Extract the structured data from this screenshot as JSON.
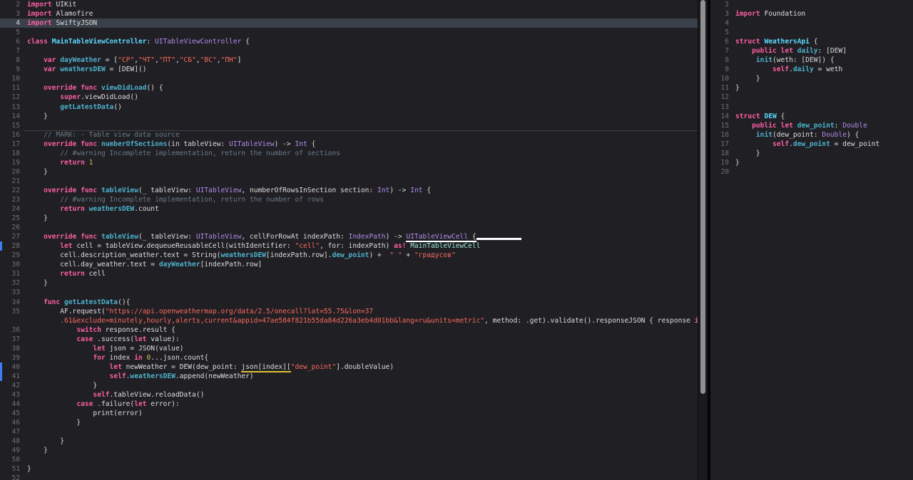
{
  "colors": {
    "background": "#1F1F24",
    "keyword": "#FC5FA3",
    "string": "#FC6A5D",
    "number": "#D0BF69",
    "comment": "#6C7986",
    "declaration_teal": "#4EB1CC",
    "sdk_type_lavender": "#B48CEB",
    "type_declaration_cyan": "#5DD8FF",
    "project_class_mint": "#9FE8D5",
    "plain_text": "#DFDFE0",
    "line_number": "#6F6F74",
    "current_line_highlight": "#3A4049",
    "change_bar_blue": "#3D7DF5",
    "scrollbar_thumb": "#8F8F94"
  },
  "left_editor": {
    "scrollbar_thumb_height": 553,
    "lines": [
      {
        "num": "2",
        "tok": [
          [
            "k",
            "import "
          ],
          [
            "p",
            "UIKit"
          ]
        ]
      },
      {
        "num": "3",
        "tok": [
          [
            "k",
            "import "
          ],
          [
            "p",
            "Alamofire"
          ]
        ]
      },
      {
        "num": "4",
        "hl": true,
        "tok": [
          [
            "k",
            "import "
          ],
          [
            "p",
            "SwiftyJSON"
          ]
        ]
      },
      {
        "num": "5",
        "tok": []
      },
      {
        "num": "6",
        "tok": [
          [
            "k",
            "class "
          ],
          [
            "y",
            "MainTableViewController"
          ],
          [
            "p",
            ": "
          ],
          [
            "t",
            "UITableViewController"
          ],
          [
            "p",
            " {"
          ]
        ]
      },
      {
        "num": "7",
        "tok": []
      },
      {
        "num": "8",
        "tok": [
          [
            "p",
            "    "
          ],
          [
            "k",
            "var "
          ],
          [
            "d",
            "dayWeather"
          ],
          [
            "p",
            " = ["
          ],
          [
            "s",
            "\"СР\""
          ],
          [
            "p",
            ","
          ],
          [
            "s",
            "\"ЧТ\""
          ],
          [
            "p",
            ","
          ],
          [
            "s",
            "\"ПТ\""
          ],
          [
            "p",
            ","
          ],
          [
            "s",
            "\"СБ\""
          ],
          [
            "p",
            ","
          ],
          [
            "s",
            "\"ВС\""
          ],
          [
            "p",
            ","
          ],
          [
            "s",
            "\"ПН\""
          ],
          [
            "p",
            "]"
          ]
        ]
      },
      {
        "num": "9",
        "tok": [
          [
            "p",
            "    "
          ],
          [
            "k",
            "var "
          ],
          [
            "d",
            "weathersDEW"
          ],
          [
            "p",
            " = [DEW]()"
          ]
        ]
      },
      {
        "num": "10",
        "tok": []
      },
      {
        "num": "11",
        "tok": [
          [
            "p",
            "    "
          ],
          [
            "k",
            "override func "
          ],
          [
            "d",
            "viewDidLoad"
          ],
          [
            "p",
            "() {"
          ]
        ]
      },
      {
        "num": "12",
        "tok": [
          [
            "p",
            "        "
          ],
          [
            "k",
            "super"
          ],
          [
            "p",
            ".viewDidLoad()"
          ]
        ]
      },
      {
        "num": "13",
        "tok": [
          [
            "p",
            "        "
          ],
          [
            "d",
            "getLatestData"
          ],
          [
            "p",
            "()"
          ]
        ]
      },
      {
        "num": "14",
        "tok": [
          [
            "p",
            "    }"
          ]
        ]
      },
      {
        "num": "15",
        "tok": []
      },
      {
        "num": "16",
        "sep": true,
        "tok": [
          [
            "p",
            "    "
          ],
          [
            "c",
            "// MARK: - Table view data source"
          ]
        ]
      },
      {
        "num": "17",
        "tok": [
          [
            "p",
            "    "
          ],
          [
            "k",
            "override func "
          ],
          [
            "d",
            "numberOfSections"
          ],
          [
            "p",
            "(in tableView: "
          ],
          [
            "t",
            "UITableView"
          ],
          [
            "p",
            ") -> "
          ],
          [
            "t",
            "Int"
          ],
          [
            "p",
            " {"
          ]
        ]
      },
      {
        "num": "18",
        "tok": [
          [
            "p",
            "        "
          ],
          [
            "c",
            "// #warning Incomplete implementation, return the number of sections"
          ]
        ]
      },
      {
        "num": "19",
        "tok": [
          [
            "p",
            "        "
          ],
          [
            "k",
            "return "
          ],
          [
            "n",
            "1"
          ]
        ]
      },
      {
        "num": "20",
        "tok": [
          [
            "p",
            "    }"
          ]
        ]
      },
      {
        "num": "21",
        "tok": []
      },
      {
        "num": "22",
        "tok": [
          [
            "p",
            "    "
          ],
          [
            "k",
            "override func "
          ],
          [
            "d",
            "tableView"
          ],
          [
            "p",
            "(_ tableView: "
          ],
          [
            "t",
            "UITableView"
          ],
          [
            "p",
            ", numberOfRowsInSection section: "
          ],
          [
            "t",
            "Int"
          ],
          [
            "p",
            ") -> "
          ],
          [
            "t",
            "Int"
          ],
          [
            "p",
            " {"
          ]
        ]
      },
      {
        "num": "23",
        "tok": [
          [
            "p",
            "        "
          ],
          [
            "c",
            "// #warning Incomplete implementation, return the number of rows"
          ]
        ]
      },
      {
        "num": "24",
        "tok": [
          [
            "p",
            "        "
          ],
          [
            "k",
            "return "
          ],
          [
            "d",
            "weathersDEW"
          ],
          [
            "p",
            ".count"
          ]
        ]
      },
      {
        "num": "25",
        "tok": [
          [
            "p",
            "    }"
          ]
        ]
      },
      {
        "num": "26",
        "tok": []
      },
      {
        "num": "27",
        "tok": [
          [
            "p",
            "    "
          ],
          [
            "k",
            "override func "
          ],
          [
            "d",
            "tableView"
          ],
          [
            "p",
            "(_ tableView: "
          ],
          [
            "t",
            "UITableView"
          ],
          [
            "p",
            ", cellForRowAt indexPath: "
          ],
          [
            "t",
            "IndexPath"
          ],
          [
            "p",
            ") -> "
          ],
          [
            "tu",
            "UITableViewCell"
          ],
          [
            "pu",
            " {"
          ],
          [
            "wb",
            ""
          ]
        ]
      },
      {
        "num": "28",
        "chbar": true,
        "tok": [
          [
            "p",
            "        "
          ],
          [
            "k",
            "let "
          ],
          [
            "p",
            "cell = tableView.dequeueReusableCell(withIdentifier: "
          ],
          [
            "s",
            "\"cell\""
          ],
          [
            "p",
            ", for: indexPath) "
          ],
          [
            "k",
            "as!"
          ],
          [
            "p",
            " "
          ],
          [
            "m",
            "MainTableViewCell"
          ]
        ]
      },
      {
        "num": "29",
        "tok": [
          [
            "p",
            "        "
          ],
          [
            "p",
            "cell.description_weather.text = String("
          ],
          [
            "d",
            "weathersDEW"
          ],
          [
            "p",
            "[indexPath.row]."
          ],
          [
            "d",
            "dew_point"
          ],
          [
            "p",
            ") +  "
          ],
          [
            "s",
            "\" \""
          ],
          [
            "p",
            " + "
          ],
          [
            "s",
            "\"градусов\""
          ]
        ]
      },
      {
        "num": "30",
        "tok": [
          [
            "p",
            "        "
          ],
          [
            "p",
            "cell.day_weather.text = "
          ],
          [
            "d",
            "dayWeather"
          ],
          [
            "p",
            "[indexPath.row]"
          ]
        ]
      },
      {
        "num": "31",
        "tok": [
          [
            "p",
            "        "
          ],
          [
            "k",
            "return "
          ],
          [
            "p",
            "cell"
          ]
        ]
      },
      {
        "num": "32",
        "tok": [
          [
            "p",
            "    }"
          ]
        ]
      },
      {
        "num": "33",
        "tok": []
      },
      {
        "num": "34",
        "tok": [
          [
            "p",
            "    "
          ],
          [
            "k",
            "func "
          ],
          [
            "d",
            "getLatestData"
          ],
          [
            "p",
            "(){"
          ]
        ]
      },
      {
        "num": "35",
        "tok": [
          [
            "p",
            "        "
          ],
          [
            "p",
            "AF.request("
          ],
          [
            "s",
            "\"https://api.openweathermap.org/data/2.5/onecall?lat=55.75&lon=37"
          ]
        ]
      },
      {
        "num": "",
        "tok": [
          [
            "p",
            "        "
          ],
          [
            "s",
            ".61&exclude=minutely,hourly,alerts,current&appid=47ae584f821b55da84d226a3eb4d01bb&lang=ru&units=metric\""
          ],
          [
            "p",
            ", method: .get).validate().responseJSON { response "
          ],
          [
            "k",
            "in"
          ]
        ]
      },
      {
        "num": "36",
        "tok": [
          [
            "p",
            "            "
          ],
          [
            "k",
            "switch "
          ],
          [
            "p",
            "response.result {"
          ]
        ]
      },
      {
        "num": "37",
        "tok": [
          [
            "p",
            "            "
          ],
          [
            "k",
            "case "
          ],
          [
            "p",
            ".success("
          ],
          [
            "k",
            "let"
          ],
          [
            "p",
            " value):"
          ]
        ]
      },
      {
        "num": "38",
        "tok": [
          [
            "p",
            "                "
          ],
          [
            "k",
            "let "
          ],
          [
            "p",
            "json = JSON(value)"
          ]
        ]
      },
      {
        "num": "39",
        "tok": [
          [
            "p",
            "                "
          ],
          [
            "k",
            "for "
          ],
          [
            "p",
            "index "
          ],
          [
            "k",
            "in "
          ],
          [
            "n",
            "0"
          ],
          [
            "p",
            "...json.count{"
          ]
        ]
      },
      {
        "num": "40",
        "chbar": true,
        "tok": [
          [
            "p",
            "                    "
          ],
          [
            "k",
            "let "
          ],
          [
            "p",
            "newWeather = DEW(dew_point: "
          ],
          [
            "yu",
            "json[index]["
          ],
          [
            "s",
            "\"dew_point\""
          ],
          [
            "p",
            "].doubleValue)"
          ]
        ]
      },
      {
        "num": "41",
        "chbar": true,
        "tok": [
          [
            "p",
            "                    "
          ],
          [
            "k",
            "self"
          ],
          [
            "p",
            "."
          ],
          [
            "d",
            "weathersDEW"
          ],
          [
            "p",
            ".append(newWeather)"
          ]
        ]
      },
      {
        "num": "42",
        "tok": [
          [
            "p",
            "                }"
          ]
        ]
      },
      {
        "num": "43",
        "tok": [
          [
            "p",
            "                "
          ],
          [
            "k",
            "self"
          ],
          [
            "p",
            ".tableView.reloadData()"
          ]
        ]
      },
      {
        "num": "44",
        "tok": [
          [
            "p",
            "            "
          ],
          [
            "k",
            "case "
          ],
          [
            "p",
            ".failure("
          ],
          [
            "k",
            "let"
          ],
          [
            "p",
            " error):"
          ]
        ]
      },
      {
        "num": "45",
        "tok": [
          [
            "p",
            "                "
          ],
          [
            "p",
            "print(error)"
          ]
        ]
      },
      {
        "num": "46",
        "tok": [
          [
            "p",
            "            }"
          ]
        ]
      },
      {
        "num": "47",
        "tok": []
      },
      {
        "num": "48",
        "tok": [
          [
            "p",
            "        }"
          ]
        ]
      },
      {
        "num": "49",
        "tok": [
          [
            "p",
            "    }"
          ]
        ]
      },
      {
        "num": "50",
        "tok": []
      },
      {
        "num": "51",
        "tok": [
          [
            "p",
            "}"
          ]
        ]
      },
      {
        "num": "52",
        "tok": []
      }
    ]
  },
  "right_editor": {
    "lines": [
      {
        "num": "2",
        "tok": []
      },
      {
        "num": "3",
        "tok": [
          [
            "k",
            "import "
          ],
          [
            "p",
            "Foundation"
          ]
        ]
      },
      {
        "num": "4",
        "tok": []
      },
      {
        "num": "5",
        "tok": []
      },
      {
        "num": "6",
        "tok": [
          [
            "k",
            "struct "
          ],
          [
            "y",
            "WeathersApi"
          ],
          [
            "p",
            " {"
          ]
        ]
      },
      {
        "num": "7",
        "tok": [
          [
            "p",
            "    "
          ],
          [
            "k",
            "public let "
          ],
          [
            "d",
            "daily"
          ],
          [
            "p",
            ": [DEW]"
          ]
        ]
      },
      {
        "num": "8",
        "tok": [
          [
            "p",
            "     "
          ],
          [
            "d",
            "init"
          ],
          [
            "p",
            "(weth: [DEW]) {"
          ]
        ]
      },
      {
        "num": "9",
        "tok": [
          [
            "p",
            "         "
          ],
          [
            "k",
            "self"
          ],
          [
            "p",
            "."
          ],
          [
            "d",
            "daily"
          ],
          [
            "p",
            " = weth"
          ]
        ]
      },
      {
        "num": "10",
        "tok": [
          [
            "p",
            "     }"
          ]
        ]
      },
      {
        "num": "11",
        "tok": [
          [
            "p",
            "}"
          ]
        ]
      },
      {
        "num": "12",
        "tok": []
      },
      {
        "num": "13",
        "tok": []
      },
      {
        "num": "14",
        "tok": [
          [
            "k",
            "struct "
          ],
          [
            "y",
            "DEW"
          ],
          [
            "p",
            " {"
          ]
        ]
      },
      {
        "num": "15",
        "tok": [
          [
            "p",
            "    "
          ],
          [
            "k",
            "public let "
          ],
          [
            "d",
            "dew_point"
          ],
          [
            "p",
            ": "
          ],
          [
            "t",
            "Double"
          ]
        ]
      },
      {
        "num": "16",
        "tok": [
          [
            "p",
            "     "
          ],
          [
            "d",
            "init"
          ],
          [
            "p",
            "(dew_point: "
          ],
          [
            "t",
            "Double"
          ],
          [
            "p",
            ") {"
          ]
        ]
      },
      {
        "num": "17",
        "tok": [
          [
            "p",
            "         "
          ],
          [
            "k",
            "self"
          ],
          [
            "p",
            "."
          ],
          [
            "d",
            "dew_point"
          ],
          [
            "p",
            " = dew_point"
          ]
        ]
      },
      {
        "num": "18",
        "tok": [
          [
            "p",
            "     }"
          ]
        ]
      },
      {
        "num": "19",
        "tok": [
          [
            "p",
            "}"
          ]
        ]
      },
      {
        "num": "20",
        "tok": []
      }
    ]
  }
}
